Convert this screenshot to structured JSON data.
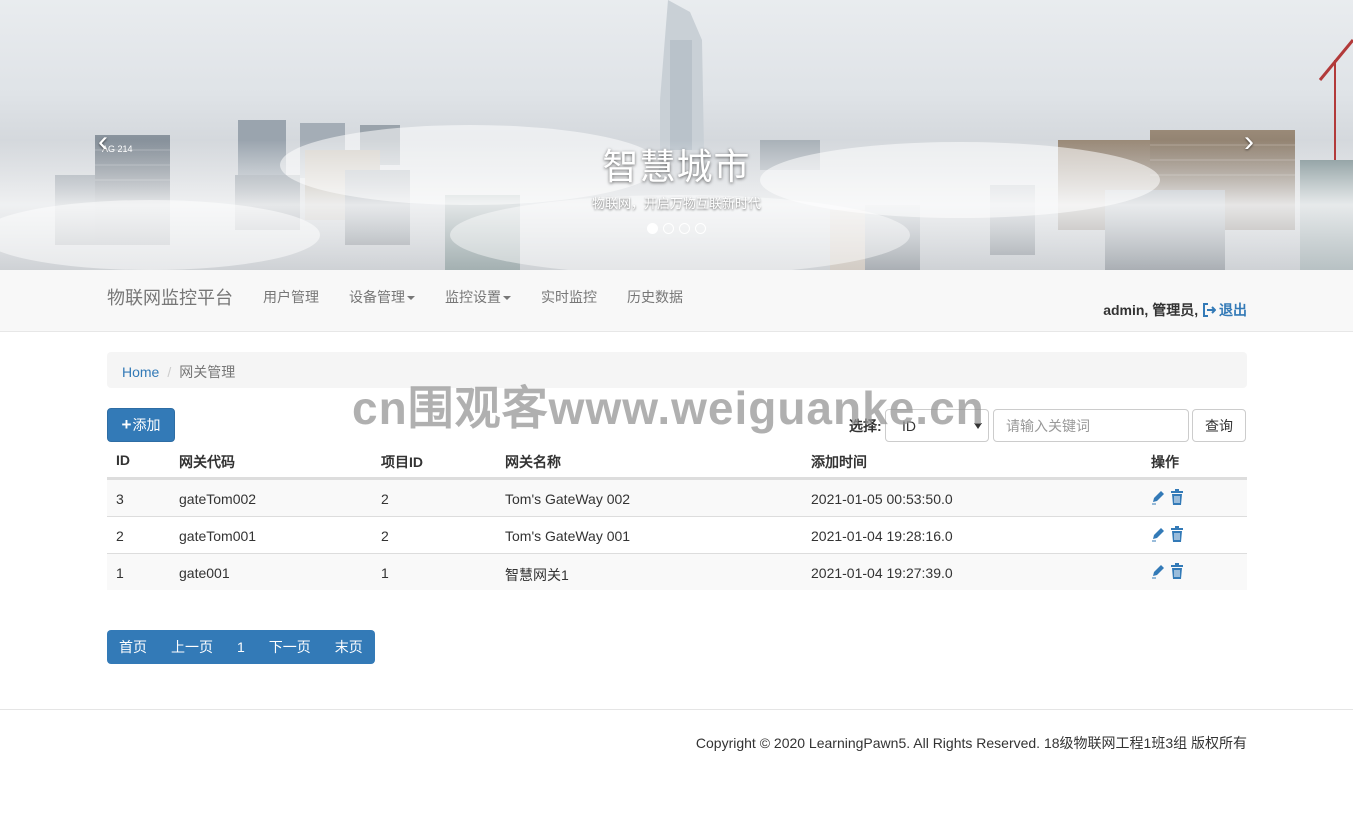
{
  "banner": {
    "title": "智慧城市",
    "subtitle": "物联网，开启万物互联新时代",
    "slide_count": 4,
    "active_slide": 1,
    "building_sign": "AG 214"
  },
  "navbar": {
    "brand": "物联网监控平台",
    "items": [
      {
        "label": "用户管理",
        "dropdown": false
      },
      {
        "label": "设备管理",
        "dropdown": true
      },
      {
        "label": "监控设置",
        "dropdown": true
      },
      {
        "label": "实时监控",
        "dropdown": false
      },
      {
        "label": "历史数据",
        "dropdown": false
      }
    ],
    "user": "admin, 管理员,",
    "logout_label": "退出"
  },
  "breadcrumb": {
    "home": "Home",
    "separator": "/",
    "current": "网关管理"
  },
  "watermark": "cn围观客www.weiguanke.cn",
  "toolbar": {
    "add_label": "添加",
    "search_label": "选择:",
    "select_value": "ID",
    "keyword_placeholder": "请输入关键词",
    "query_label": "查询"
  },
  "table": {
    "headers": [
      "ID",
      "网关代码",
      "项目ID",
      "网关名称",
      "添加时间",
      "操作"
    ],
    "rows": [
      [
        "3",
        "gateTom002",
        "2",
        "Tom's GateWay 002",
        "2021-01-05 00:53:50.0"
      ],
      [
        "2",
        "gateTom001",
        "2",
        "Tom's GateWay 001",
        "2021-01-04 19:28:16.0"
      ],
      [
        "1",
        "gate001",
        "1",
        "智慧网关1",
        "2021-01-04 19:27:39.0"
      ]
    ],
    "row_actions": [
      "edit-icon",
      "delete-icon"
    ]
  },
  "pagination": {
    "first": "首页",
    "prev": "上一页",
    "current": "1",
    "next": "下一页",
    "last": "末页"
  },
  "footer": {
    "copyright": "Copyright © 2020 LearningPawn5. All Rights Reserved. 18级物联网工程1班3组 版权所有"
  },
  "colors": {
    "primary": "#337ab7",
    "navbar_bg": "#f8f8f8",
    "breadcrumb_bg": "#f5f5f5",
    "stripe": "#f9f9f9"
  }
}
